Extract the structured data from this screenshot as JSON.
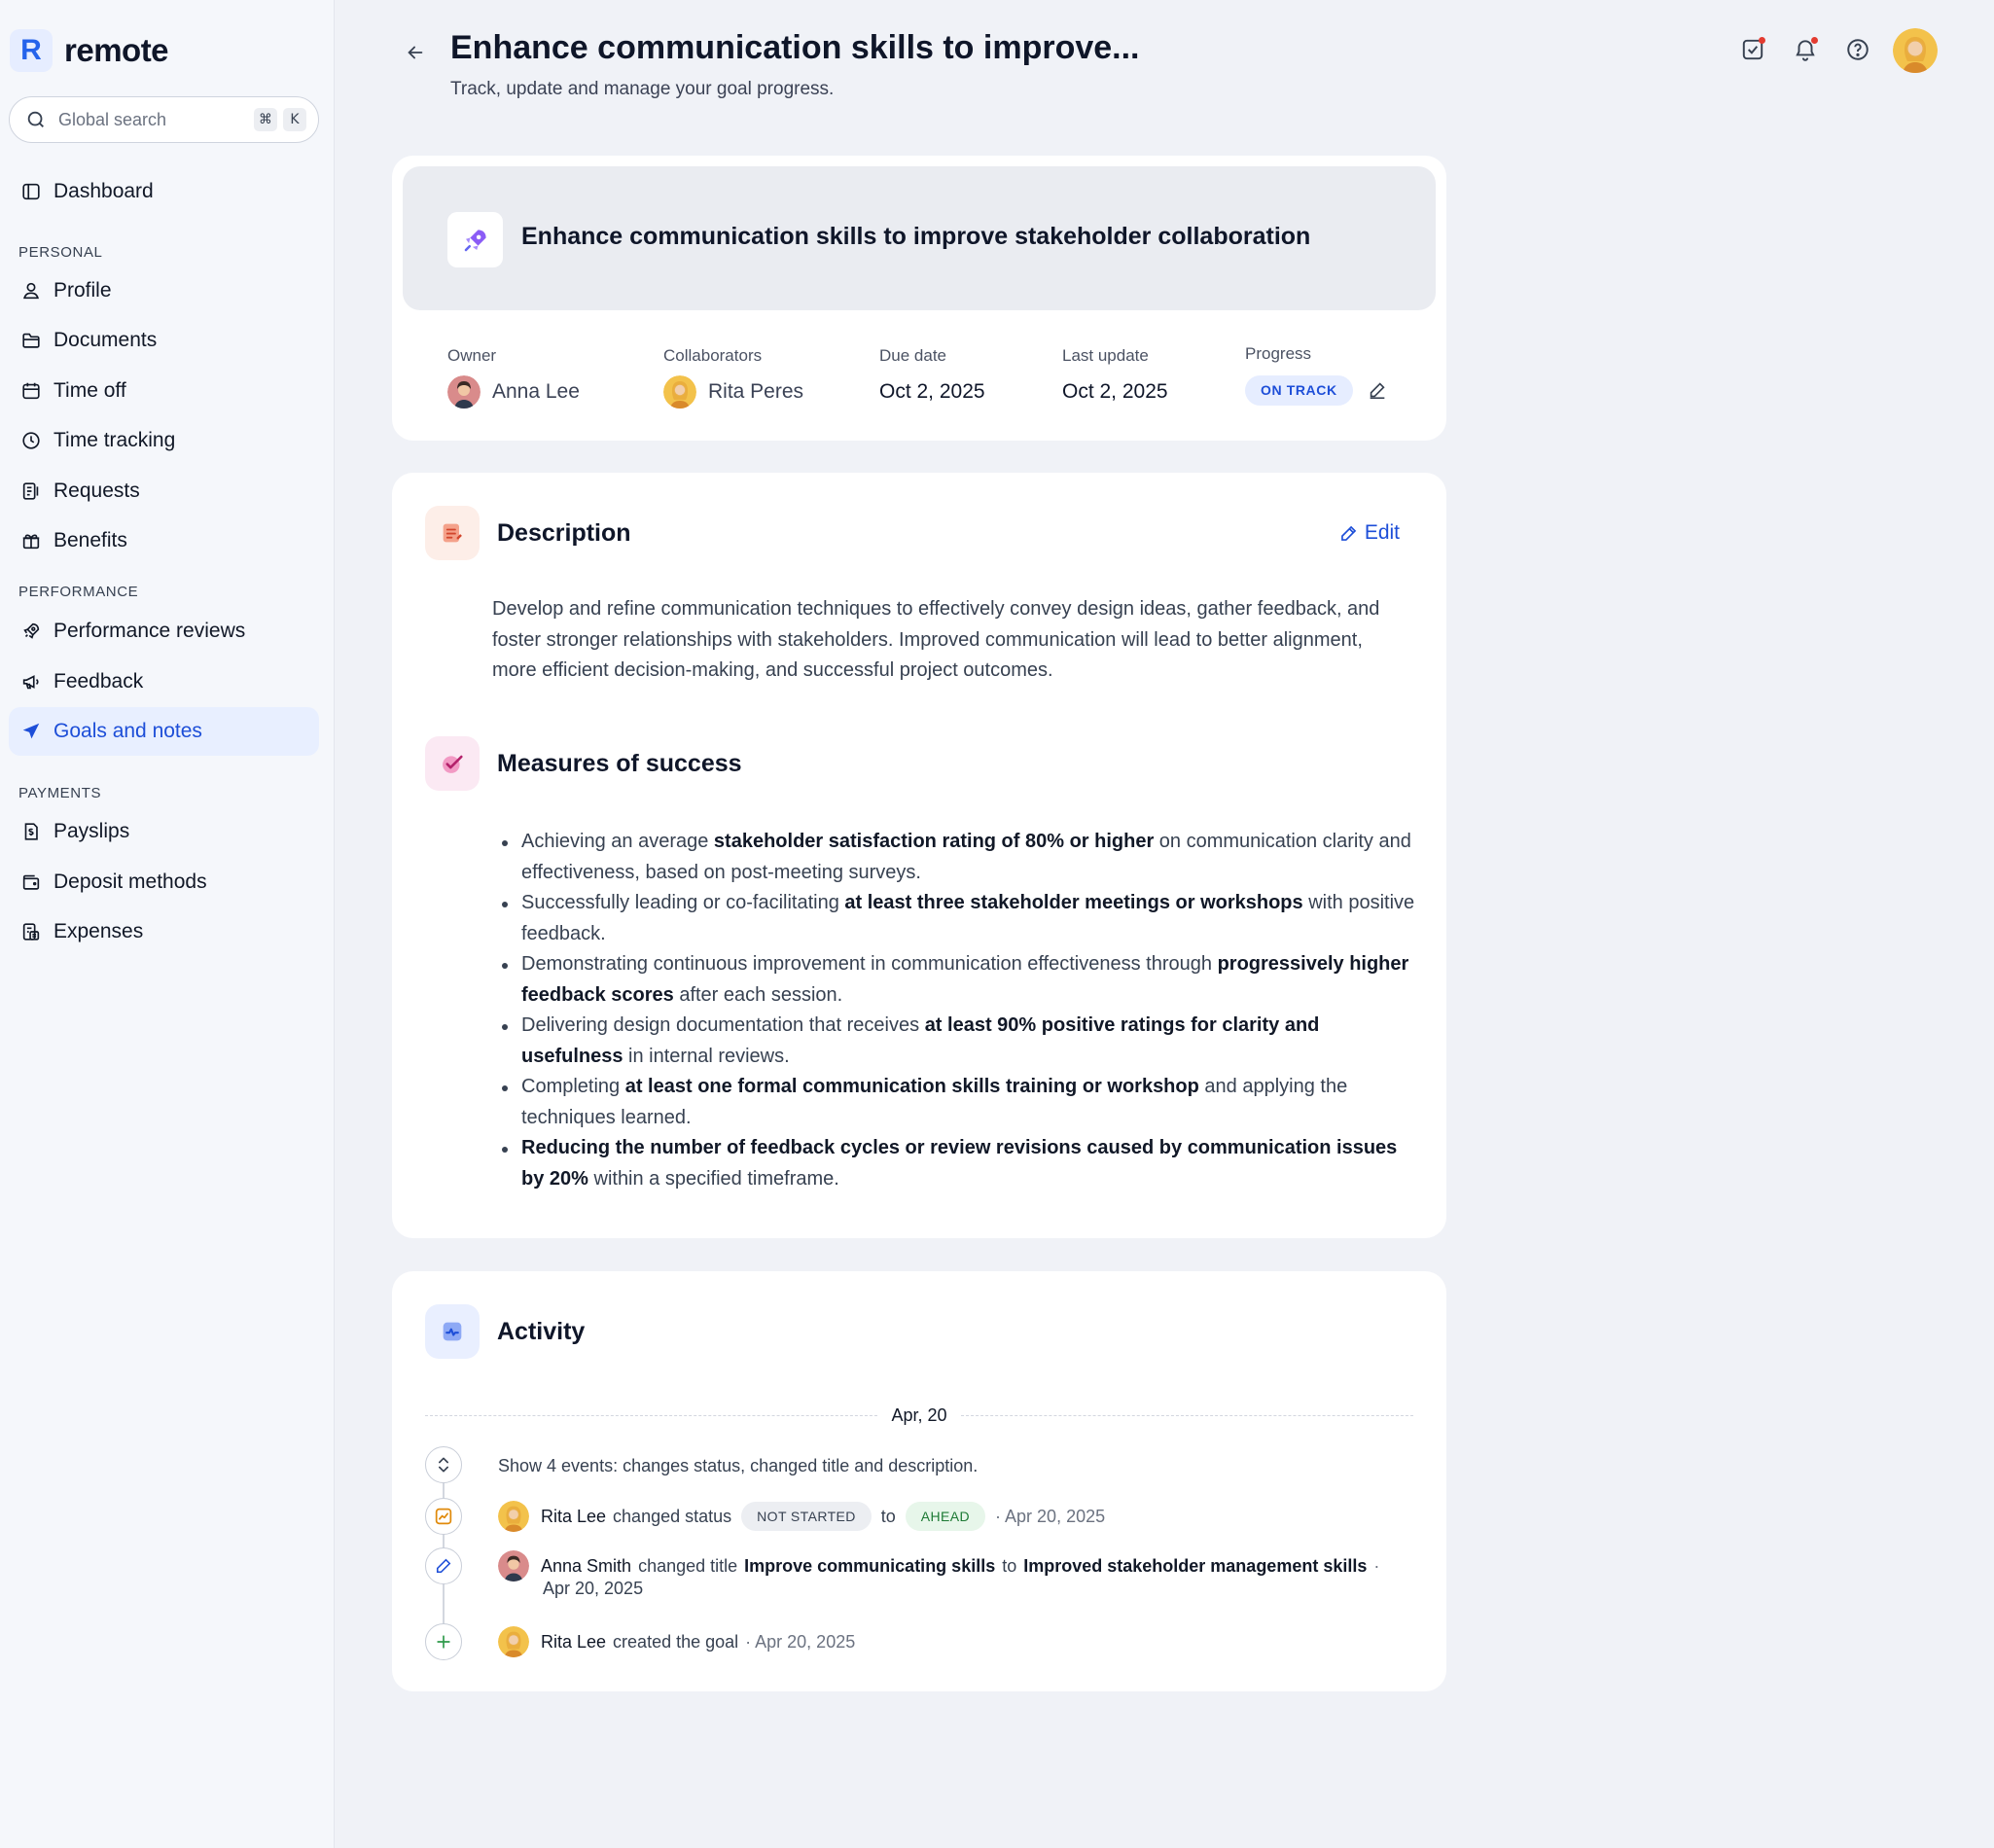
{
  "brand": {
    "name": "remote",
    "mark": "R"
  },
  "search": {
    "placeholder": "Global search",
    "shortcut_keys": [
      "⌘",
      "K"
    ]
  },
  "sidebar": {
    "dashboard": "Dashboard",
    "sections": {
      "personal": "PERSONAL",
      "performance": "PERFORMANCE",
      "payments": "PAYMENTS"
    },
    "personal_items": [
      "Profile",
      "Documents",
      "Time off",
      "Time tracking",
      "Requests",
      "Benefits"
    ],
    "performance_items": [
      "Performance reviews",
      "Feedback",
      "Goals and notes"
    ],
    "payments_items": [
      "Payslips",
      "Deposit methods",
      "Expenses"
    ],
    "active_item": "Goals and notes"
  },
  "header": {
    "title": "Enhance communication skills to improve...",
    "subtitle": "Track, update and manage your goal progress."
  },
  "goal": {
    "name": "Enhance communication skills to improve stakeholder collaboration",
    "owner_label": "Owner",
    "owner": "Anna Lee",
    "collaborators_label": "Collaborators",
    "collaborator": "Rita Peres",
    "due_label": "Due date",
    "due": "Oct 2, 2025",
    "updated_label": "Last update",
    "updated": "Oct 2, 2025",
    "progress_label": "Progress",
    "progress_status": "ON TRACK"
  },
  "description": {
    "title": "Description",
    "edit_label": "Edit",
    "text": "Develop and refine communication techniques to effectively convey design ideas, gather feedback, and foster stronger relationships with stakeholders. Improved communication will lead to better alignment, more efficient decision-making, and successful project outcomes."
  },
  "measures": {
    "title": "Measures of success",
    "items": [
      {
        "pre": "Achieving an average ",
        "bold": "stakeholder satisfaction rating of 80% or higher",
        "post": " on communication clarity and effectiveness, based on post-meeting surveys."
      },
      {
        "pre": "Successfully leading or co-facilitating ",
        "bold": "at least three stakeholder meetings or workshops",
        "post": " with positive feedback."
      },
      {
        "pre": "Demonstrating continuous improvement in communication effectiveness through ",
        "bold": "progressively higher feedback scores",
        "post": " after each session."
      },
      {
        "pre": "Delivering design documentation that receives ",
        "bold": "at least 90% positive ratings for clarity and usefulness",
        "post": " in internal reviews."
      },
      {
        "pre": "Completing ",
        "bold": "at least one formal communication skills training or workshop",
        "post": " and applying the techniques learned."
      },
      {
        "pre": "",
        "bold": "Reducing the number of feedback cycles or review revisions caused by communication issues by 20%",
        "post": " within a specified timeframe."
      }
    ]
  },
  "activity": {
    "title": "Activity",
    "date_group": "Apr, 20",
    "show_events": "Show 4 events: changes status, changed title and description.",
    "events": {
      "status": {
        "who": "Rita Lee",
        "action": "changed status",
        "from": "NOT STARTED",
        "to_word": "to",
        "to": "AHEAD",
        "date": "· Apr 20, 2025"
      },
      "title": {
        "who": "Anna Smith",
        "action": "changed title",
        "from": "Improve communicating skills",
        "to_word": "to",
        "to": "Improved stakeholder management skills",
        "date_sep": "·",
        "date": "Apr 20, 2025"
      },
      "created": {
        "who": "Rita Lee",
        "action": "created the goal",
        "date": "· Apr 20, 2025"
      }
    }
  },
  "colors": {
    "accent": "#1d4ed8",
    "active_bg": "#e8efff",
    "page_bg": "#f0f2f7"
  }
}
